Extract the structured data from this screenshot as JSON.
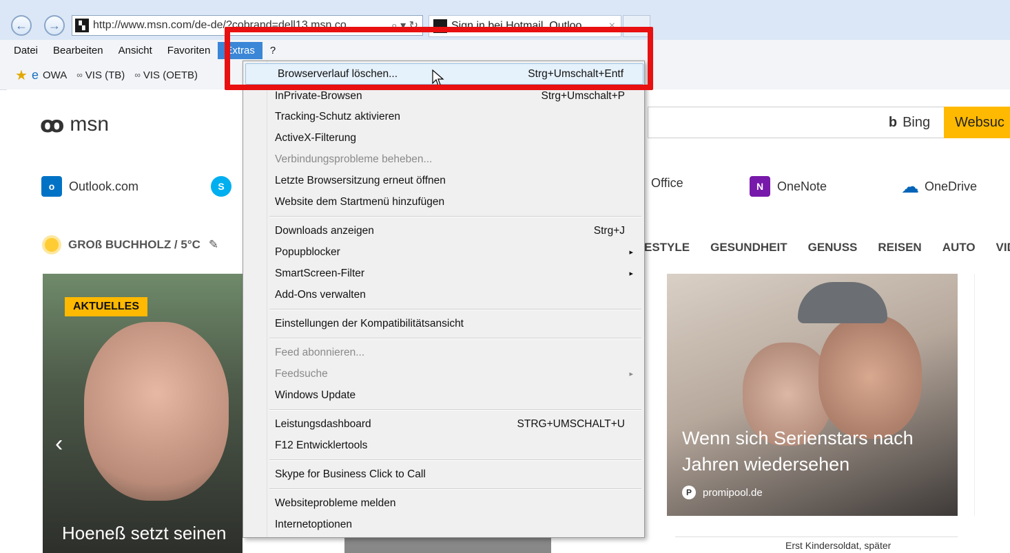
{
  "browser": {
    "address_url": "http://www.msn.com/de-de/?cobrand=dell13.msn.co",
    "address_tools": "⌕ ▾ ↻",
    "tab_title": "Sign in bei Hotmail, Outloo",
    "tab_close": "×",
    "back_glyph": "←",
    "forward_glyph": "→"
  },
  "menubar": {
    "items": [
      "Datei",
      "Bearbeiten",
      "Ansicht",
      "Favoriten",
      "Extras",
      "?"
    ]
  },
  "favorites": {
    "items": [
      "OWA",
      "VIS (TB)",
      "VIS (OETB)"
    ]
  },
  "page": {
    "logo_text": "msn",
    "bing_label": "Bing",
    "websearch_label": "Websuc",
    "services": [
      {
        "label": "Outlook.com",
        "icon_text": "o",
        "color": "#0072c6"
      },
      {
        "label": "Office",
        "icon_text": "",
        "color": "#d83b01"
      },
      {
        "label": "OneNote",
        "icon_text": "N",
        "color": "#7719aa"
      },
      {
        "label": "OneDrive",
        "icon_text": "☁",
        "color": "#0364b8"
      }
    ],
    "skype_icon_text": "S",
    "weather": "GROß BUCHHOLZ / 5°C",
    "weather_edit_glyph": "✎",
    "nav_categories": [
      "ESTYLE",
      "GESUNDHEIT",
      "GENUSS",
      "REISEN",
      "AUTO",
      "VID"
    ],
    "card1": {
      "badge": "AKTUELLES",
      "caption": "Hoeneß setzt seinen",
      "arrow": "‹"
    },
    "card2": {
      "title": "Wenn sich Serienstars nach Jahren wiedersehen",
      "source": "promipool.de",
      "source_icon": "P"
    },
    "card4_text": "Erst Kindersoldat, später"
  },
  "dropdown": {
    "items": [
      {
        "label": "Browserverlauf löschen...",
        "shortcut": "Strg+Umschalt+Entf"
      },
      {
        "label": "InPrivate-Browsen",
        "shortcut": "Strg+Umschalt+P"
      },
      {
        "label": "Tracking-Schutz aktivieren",
        "shortcut": ""
      },
      {
        "label": "ActiveX-Filterung",
        "shortcut": ""
      },
      {
        "label": "Verbindungsprobleme beheben...",
        "shortcut": ""
      },
      {
        "label": "Letzte Browsersitzung erneut öffnen",
        "shortcut": ""
      },
      {
        "label": "Website dem Startmenü hinzufügen",
        "shortcut": ""
      },
      {
        "label": "Downloads anzeigen",
        "shortcut": "Strg+J"
      },
      {
        "label": "Popupblocker",
        "shortcut": ""
      },
      {
        "label": "SmartScreen-Filter",
        "shortcut": ""
      },
      {
        "label": "Add-Ons verwalten",
        "shortcut": ""
      },
      {
        "label": "Einstellungen der Kompatibilitätsansicht",
        "shortcut": ""
      },
      {
        "label": "Feed abonnieren...",
        "shortcut": ""
      },
      {
        "label": "Feedsuche",
        "shortcut": ""
      },
      {
        "label": "Windows Update",
        "shortcut": ""
      },
      {
        "label": "Leistungsdashboard",
        "shortcut": "STRG+UMSCHALT+U"
      },
      {
        "label": "F12 Entwicklertools",
        "shortcut": ""
      },
      {
        "label": "Skype for Business Click to Call",
        "shortcut": ""
      },
      {
        "label": "Websiteprobleme melden",
        "shortcut": ""
      },
      {
        "label": "Internetoptionen",
        "shortcut": ""
      }
    ],
    "submenu_arrow": "▸"
  },
  "colors": {
    "highlight_box": "#e81010",
    "menu_active": "#3b86d6",
    "websearch": "#ffb900"
  }
}
